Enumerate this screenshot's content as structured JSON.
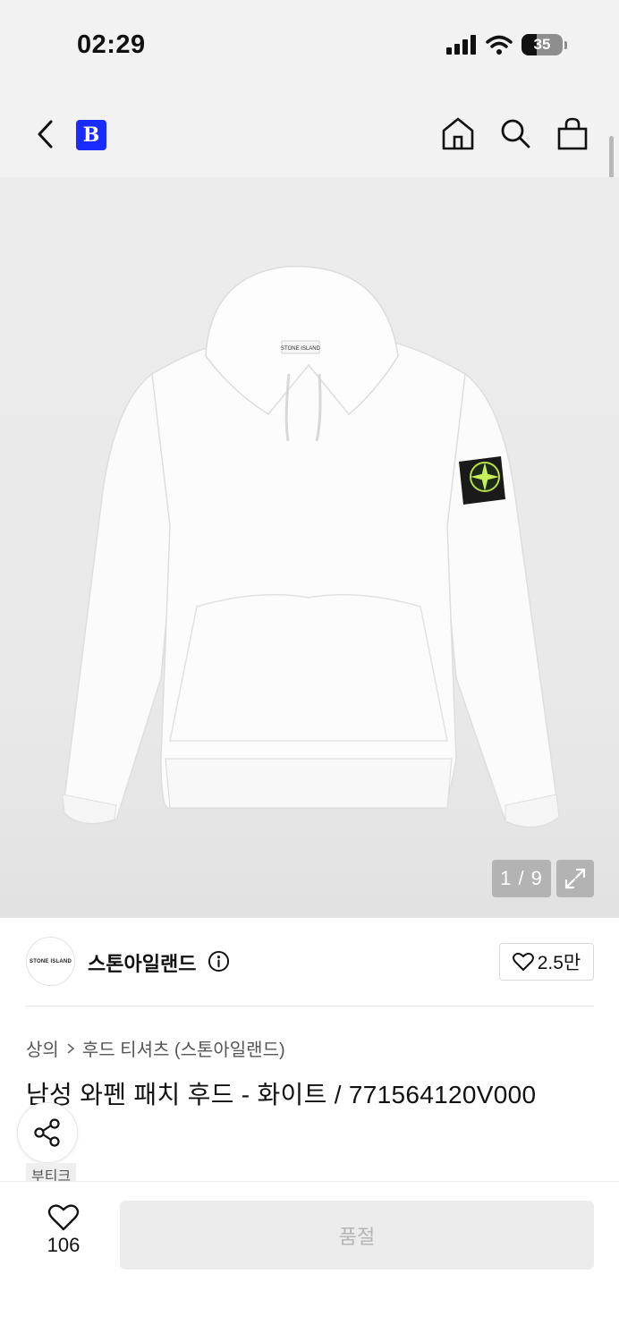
{
  "status_bar": {
    "time": "02:29",
    "battery": "35"
  },
  "header": {
    "brand_badge": "B",
    "icons": [
      "back-icon",
      "home-icon",
      "search-icon",
      "shopping-bag-icon"
    ]
  },
  "gallery": {
    "counter": "1 / 9"
  },
  "brand": {
    "logo_text": "STONE ISLAND",
    "name": "스톤아일랜드",
    "likes": "2.5만"
  },
  "breadcrumb": {
    "level1": "상의",
    "level2": "후드 티셔츠 (스톤아일랜드)"
  },
  "product": {
    "title": "남성 와펜 패치 후드 - 화이트 / 771564120V000",
    "tag": "부티크"
  },
  "bottom_bar": {
    "wish_count": "106",
    "soldout_label": "품절"
  }
}
